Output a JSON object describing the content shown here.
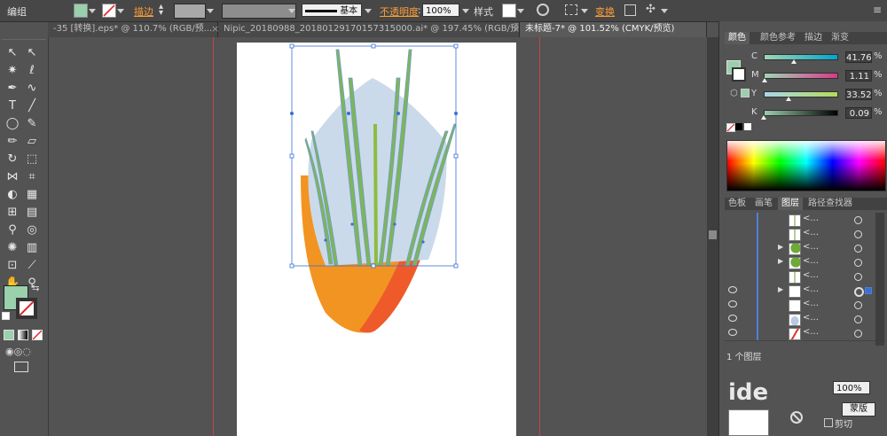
{
  "control_bar": {
    "group_label": "编组",
    "fill_color": "#9ad0ac",
    "stroke_label": "描边",
    "stroke_style_label": "基本",
    "opacity_label": "不透明度",
    "opacity_value": "100%",
    "style_label": "样式",
    "transform_label": "变换"
  },
  "tabs": [
    {
      "label": "-35 [转换].eps* @ 110.7% (RGB/预..."
    },
    {
      "label": "Nipic_20180988_20180129170157315000.ai* @ 197.45% (RGB/预..."
    },
    {
      "label": "未标题-7* @ 101.52% (CMYK/预览)"
    }
  ],
  "tab_close_glyph": "×",
  "color_panel": {
    "tabs": [
      "颜色",
      "颜色参考",
      "描边",
      "渐变"
    ],
    "channels": [
      {
        "name": "C",
        "value": "41.76",
        "fraction": 0.42,
        "track": "linear-gradient(90deg,#9fd6b3,#00a6ce)"
      },
      {
        "name": "M",
        "value": "1.11",
        "fraction": 0.01,
        "track": "linear-gradient(90deg,#9fd6b3,#d8398d)"
      },
      {
        "name": "Y",
        "value": "33.52",
        "fraction": 0.34,
        "track": "linear-gradient(90deg,#a9d7ea,#b6d95b)"
      },
      {
        "name": "K",
        "value": "0.09",
        "fraction": 0.0,
        "track": "linear-gradient(90deg,#9ad0ac,#000000)"
      }
    ]
  },
  "layers_panel": {
    "tabs": [
      "色板",
      "画笔",
      "图层",
      "路径查找器"
    ],
    "rows": [
      {
        "name": "<...",
        "thumb": "stroke",
        "visible": false,
        "expand": false,
        "selected": false
      },
      {
        "name": "<...",
        "thumb": "stroke",
        "visible": false,
        "expand": false,
        "selected": false
      },
      {
        "name": "<...",
        "thumb": "leaf",
        "visible": false,
        "expand": true,
        "selected": false
      },
      {
        "name": "<...",
        "thumb": "leaf",
        "visible": false,
        "expand": true,
        "selected": false
      },
      {
        "name": "<...",
        "thumb": "stroke",
        "visible": false,
        "expand": false,
        "selected": false
      },
      {
        "name": "<...",
        "thumb": "blank",
        "visible": true,
        "expand": true,
        "selected": true
      },
      {
        "name": "<...",
        "thumb": "blank",
        "visible": true,
        "expand": false,
        "selected": false
      },
      {
        "name": "<...",
        "thumb": "blob",
        "visible": true,
        "expand": false,
        "selected": false
      },
      {
        "name": "<...",
        "thumb": "red",
        "visible": true,
        "expand": false,
        "selected": false
      }
    ],
    "footer_count": "1 个图层"
  },
  "transparency_panel": {
    "opacity_value": "100%",
    "mask_button": "蒙版",
    "clip_label": "剪切",
    "watermark_text": "ide"
  }
}
